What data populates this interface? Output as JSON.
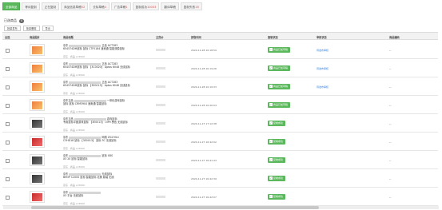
{
  "tabs": [
    {
      "label": "全部商品",
      "count": "",
      "active": true
    },
    {
      "label": "等待复制",
      "count": "",
      "active": false
    },
    {
      "label": "正在复制",
      "count": "",
      "active": false
    },
    {
      "label": "商品信息草稿",
      "count": "52",
      "active": false
    },
    {
      "label": "去除草稿",
      "count": "4",
      "active": false
    },
    {
      "label": "广告草稿",
      "count": "1",
      "active": false
    },
    {
      "label": "复制成功",
      "count": "10003",
      "active": false
    },
    {
      "label": "翻译草稿",
      "count": "",
      "active": false
    },
    {
      "label": "复制失败",
      "count": "18",
      "active": false
    }
  ],
  "selected": {
    "label": "已选商品",
    "count": "0"
  },
  "actions": [
    "批量发布",
    "批量删除",
    "导出"
  ],
  "table": {
    "headers": [
      "全选",
      "商品图片",
      "商品标题",
      "主货价",
      "抓取时间",
      "复制状态",
      "审核状态",
      "商品编码"
    ],
    "rows": [
      {
        "title_start": "京东",
        "title_end": "正品 ACT283",
        "title_line2": "654574DM鼠标 鼠标 CTF0184 速卖通 智能双模鼠标",
        "title_line3": "",
        "sub": "京东 · 商品 ≥ 8000",
        "time": "2024-11-28 10:18:59",
        "status": "商品已加草稿",
        "review": "待发布审核",
        "code": "--",
        "img": "orange"
      },
      {
        "title_start": "京东",
        "title_end": "正品 ACT283",
        "title_line2": "654574DM鼠标 鼠标 【3C0020】 Aptos 6048 无线鼠标",
        "title_line3": "",
        "sub": "京东 · 商品 ≥ 8000",
        "time": "2024-11-28 10:19:26",
        "status": "商品已加草稿",
        "review": "待发布审核",
        "code": "--",
        "img": "orange"
      },
      {
        "title_start": "京东",
        "title_end": "正品 ACT283",
        "title_line2": "654574DM鼠标 鼠标 【3E0013】 Aptos 6048 无线鼠标",
        "title_line3": "",
        "sub": "京东 · 商品 ≥ 8000",
        "time": "2024-11-28 10:19:33",
        "status": "商品已加草稿",
        "review": "待发布审核",
        "code": "--",
        "img": "orange"
      },
      {
        "title_start": "京东正品",
        "title_end": "一体化游戏鼠标",
        "title_line2": "鼠标 鼠标 CRM3904 速卖通 智能鼠标",
        "title_line3": "",
        "sub": "京东 · 商品 ≥ 8000",
        "time": "2024-11-28 10:20:04",
        "status": "商品已加草稿",
        "review": "",
        "code": "--",
        "img": "orange"
      },
      {
        "title_start": "京东正品",
        "title_end": "游戏鼠标",
        "title_line2": "专用鼠标平面游戏鼠标 【3E0013】 UIP9 黑色 无线鼠标",
        "title_line3": "",
        "sub": "京东 · 商品 ≥ 8000",
        "time": "2024-11-27 17:12:38",
        "status": "复制成功",
        "review": "",
        "code": "--",
        "img": "dark"
      },
      {
        "title_start": "京东",
        "title_end": "网络 ZS4 Mini",
        "title_line2": "C3HD18 鼠标 【3E0013】 鼠标 3C 无线鼠标",
        "title_line3": "",
        "sub": "京东 · 商品 ≥ 8000",
        "time": "2024-11-27 16:42:02",
        "status": "复制成功",
        "review": "",
        "code": "--",
        "img": "red"
      },
      {
        "title_start": "京东",
        "title_end": "鼠标 X8S",
        "title_line2": "X3 20 鼠标 智能鼠标",
        "title_line3": "",
        "sub": "京东 · 商品 ≥ 8000",
        "time": "2024-11-27 16:41:43",
        "status": "复制成功",
        "review": "",
        "code": "--",
        "img": "dark"
      },
      {
        "title_start": "京东",
        "title_end": "无线鼠标",
        "title_line2": "BM3P C2000 鼠标 智能鼠标 北美 原装 无线",
        "title_line3": "",
        "sub": "京东 · 商品 ≥ 8000",
        "time": "2024-11-27 16:42:39",
        "status": "复制成功",
        "review": "",
        "code": "--",
        "img": "dark"
      },
      {
        "title_start": "京东",
        "title_end": "",
        "title_line2": "X3 平台 无线鼠标",
        "title_line3": "",
        "sub": "京东 · 商品 ≥ 8000",
        "time": "2024-11-27 16:42:07",
        "status": "复制成功",
        "review": "",
        "code": "--",
        "img": "red"
      }
    ]
  }
}
